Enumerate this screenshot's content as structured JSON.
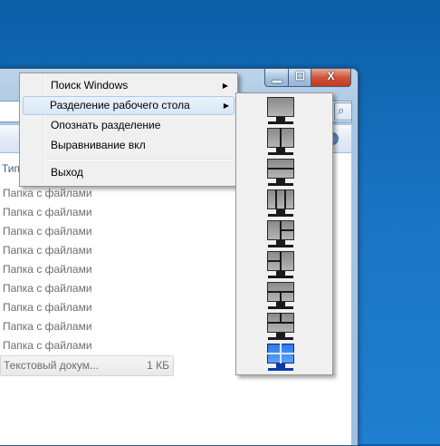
{
  "window": {
    "controls": {
      "minimize": "▁",
      "maximize": "☐",
      "close": "X"
    },
    "column_header": "Тип",
    "rows": [
      "Папка с файлами",
      "Папка с файлами",
      "Папка с файлами",
      "Папка с файлами",
      "Папка с файлами",
      "Папка с файлами",
      "Папка с файлами",
      "Папка с файлами",
      "Папка с файлами"
    ],
    "selected_row": {
      "name": "Текстовый докум...",
      "size": "1 КБ"
    }
  },
  "context_menu": {
    "items": [
      {
        "label": "Поиск Windows",
        "submenu": true
      },
      {
        "label": "Разделение рабочего стола",
        "submenu": true,
        "highlighted": true
      },
      {
        "label": "Опознать разделение"
      },
      {
        "label": "Выравнивание вкл"
      },
      {
        "label": "Выход"
      }
    ]
  },
  "split_submenu": {
    "layouts": [
      "single-monitor-icon",
      "two-columns-icon",
      "two-rows-icon",
      "three-columns-icon",
      "left-one-right-two-icon",
      "left-two-right-one-icon",
      "top-one-bottom-two-icon",
      "top-two-bottom-one-icon",
      "four-quadrants-icon"
    ],
    "active_layout": "four-quadrants-icon"
  }
}
